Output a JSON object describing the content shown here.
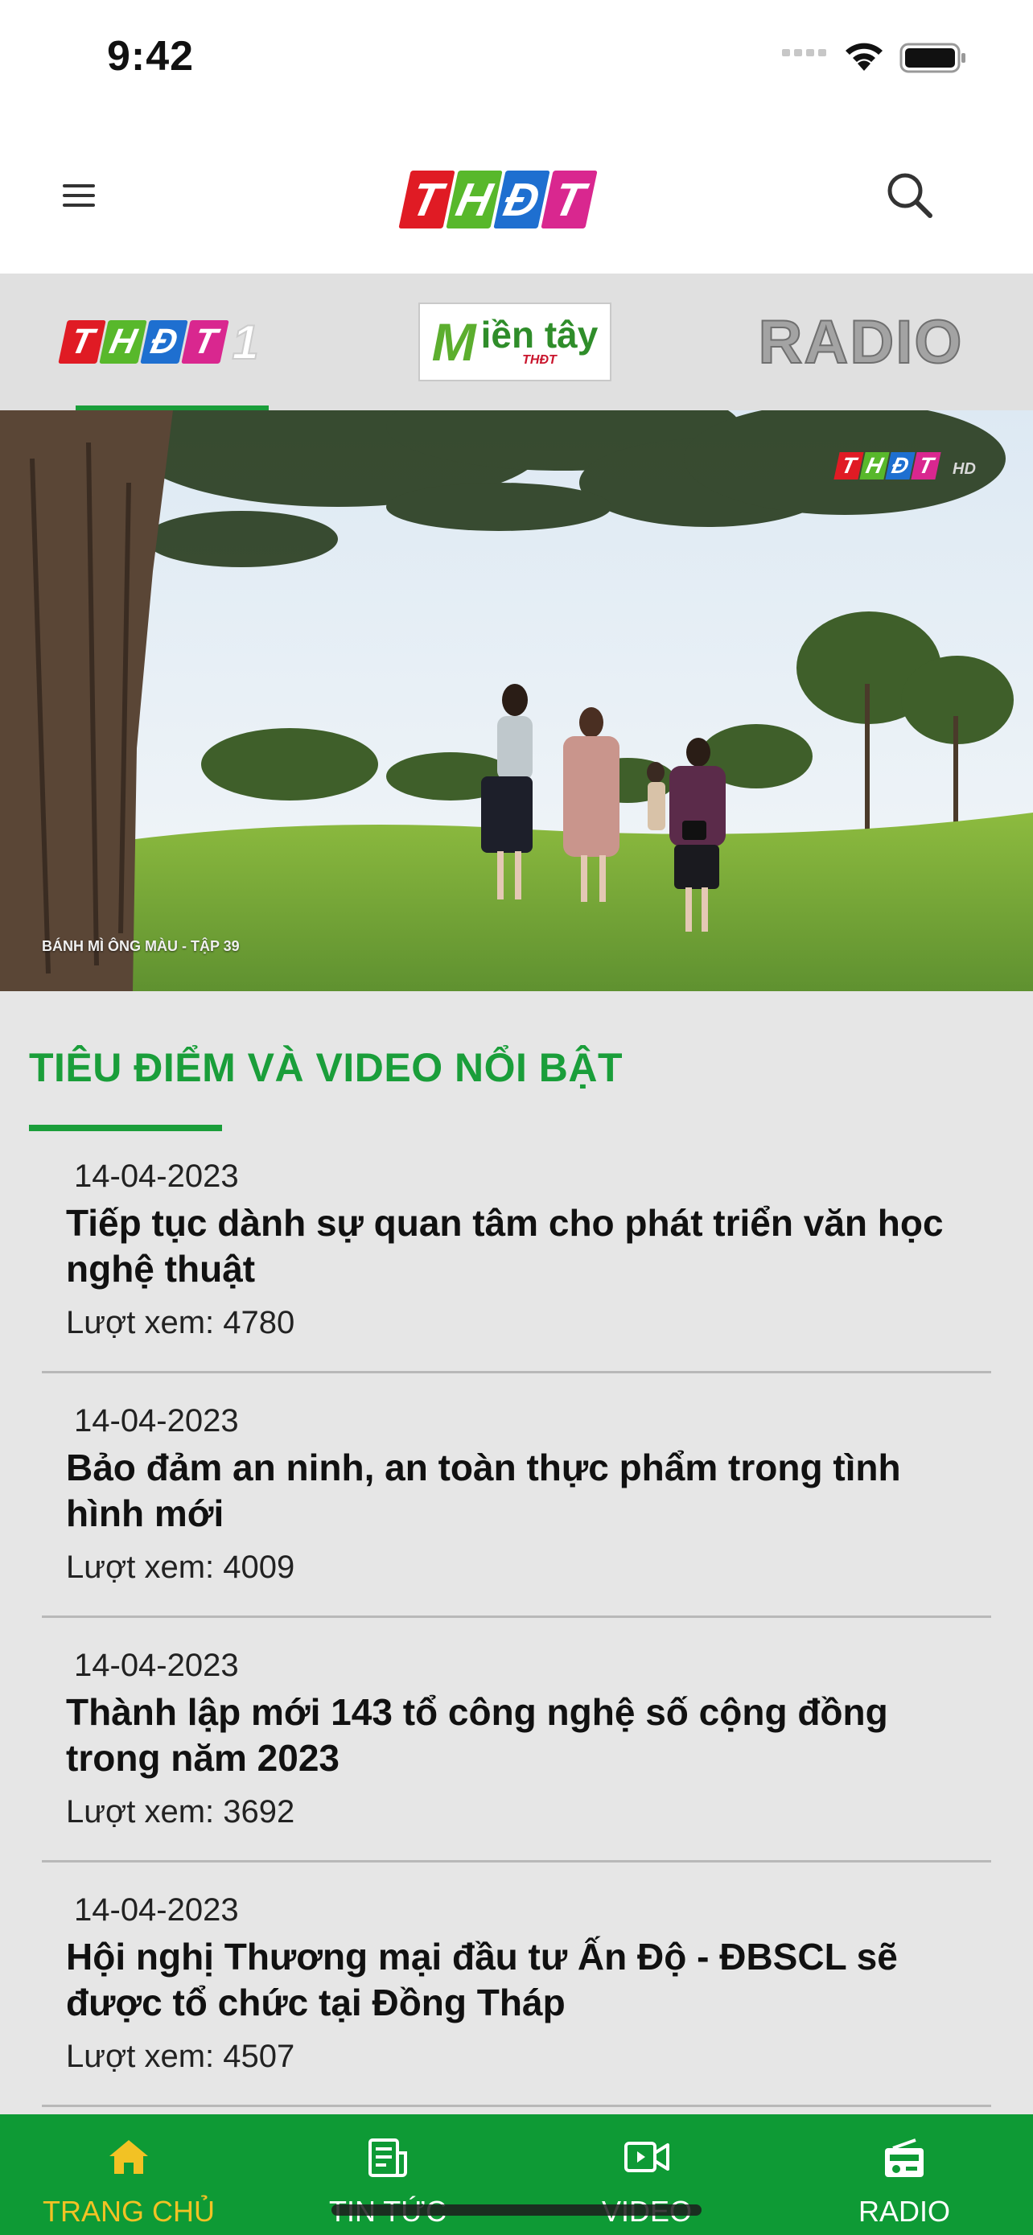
{
  "status_bar": {
    "time": "9:42"
  },
  "header": {
    "logo_letters": [
      "T",
      "H",
      "Đ",
      "T"
    ],
    "logo_colors": [
      "#e01b24",
      "#58b82b",
      "#1e6fd0",
      "#d9278f"
    ]
  },
  "channels": {
    "tab1": {
      "letters": [
        "T",
        "H",
        "Đ",
        "T"
      ],
      "suffix": "1"
    },
    "tab2": {
      "m_letter": "M",
      "word": "iền tây",
      "sub": "THĐT"
    },
    "tab3": {
      "label": "RADIO"
    }
  },
  "hero": {
    "watermark_letters": [
      "T",
      "H",
      "Đ",
      "T"
    ],
    "watermark_suffix": "HD",
    "caption": "BÁNH MÌ ÔNG MÀU - TẬP 39"
  },
  "section": {
    "title": "TIÊU ĐIỂM VÀ VIDEO NỔI BẬT"
  },
  "news": [
    {
      "date": "14-04-2023",
      "title": "Tiếp tục dành sự quan tâm cho phát triển văn học nghệ thuật",
      "views": "Lượt xem: 4780"
    },
    {
      "date": "14-04-2023",
      "title": "Bảo đảm an ninh, an toàn thực phẩm trong tình hình mới",
      "views": "Lượt xem: 4009"
    },
    {
      "date": "14-04-2023",
      "title": "Thành lập mới 143 tổ công nghệ số cộng đồng trong năm 2023",
      "views": "Lượt xem: 3692"
    },
    {
      "date": "14-04-2023",
      "title": "Hội nghị Thương mại đầu tư Ấn Độ - ĐBSCL sẽ được tổ chức tại Đồng Tháp",
      "views": "Lượt xem: 4507"
    }
  ],
  "bottom_nav": [
    {
      "label": "TRANG CHỦ",
      "icon": "home-icon",
      "active": true
    },
    {
      "label": "TIN TỨC",
      "icon": "news-icon",
      "active": false
    },
    {
      "label": "VIDEO",
      "icon": "video-icon",
      "active": false
    },
    {
      "label": "RADIO",
      "icon": "radio-icon",
      "active": false
    }
  ],
  "colors": {
    "brand_green": "#1a9e3a",
    "nav_green": "#0e9a35",
    "active_yellow": "#f2c224"
  }
}
